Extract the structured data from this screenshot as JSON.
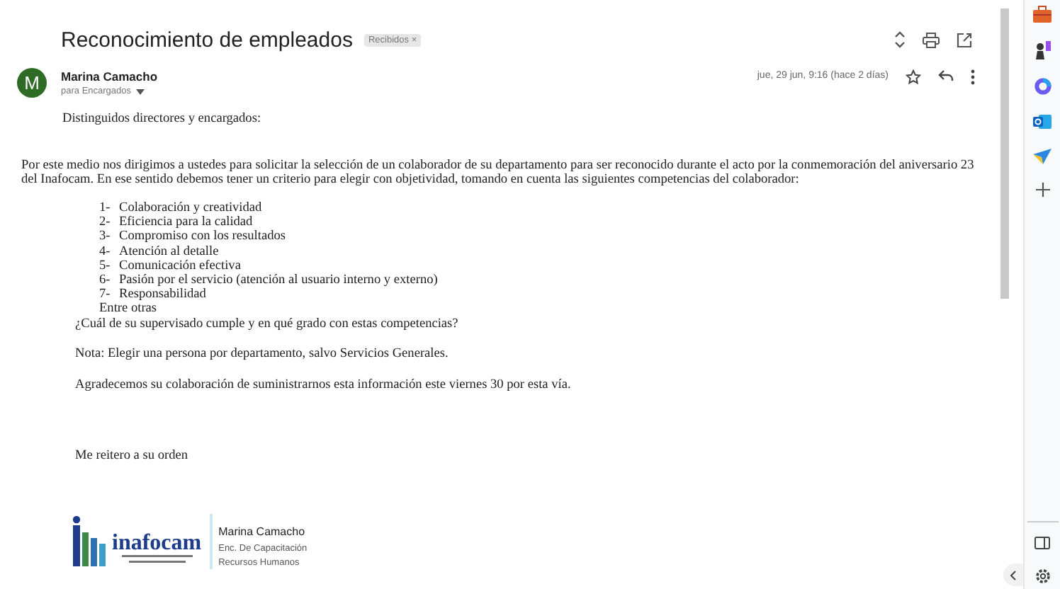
{
  "subject": "Reconocimiento de empleados",
  "label_chip": "Recibidos ×",
  "sender": {
    "initial": "M",
    "name": "Marina Camacho",
    "recipients": "para Encargados",
    "date": "jue, 29 jun, 9:16 (hace 2 días)"
  },
  "body": {
    "greeting": "Distinguidos directores y encargados:",
    "intro": "Por este medio nos dirigimos a ustedes para solicitar la selección de un colaborador de su departamento para ser reconocido durante el acto por la conmemoración del aniversario 23 del Inafocam.  En ese sentido debemos tener un criterio para elegir con objetividad, tomando en cuenta las siguientes competencias del colaborador:",
    "competencies": [
      {
        "number": "1-",
        "text": "Colaboración y creatividad"
      },
      {
        "number": "2-",
        "text": "Eficiencia para la calidad"
      },
      {
        "number": "3-",
        "text": "Compromiso con los resultados"
      },
      {
        "number": "4-",
        "text": "Atención al detalle"
      },
      {
        "number": "5-",
        "text": "Comunicación efectiva"
      },
      {
        "number": "6-",
        "text": "Pasión por el servicio (atención al usuario interno y externo)"
      },
      {
        "number": "7-",
        "text": "Responsabilidad"
      }
    ],
    "list_end": "Entre otras",
    "question": "¿Cuál de su  supervisado cumple y en qué grado con estas competencias?",
    "note": "Nota:  Elegir una persona por departamento, salvo Servicios Generales.",
    "thanks": "Agradecemos su colaboración de suministrarnos esta información este viernes 30 por esta vía.",
    "closing": "Me reitero a su orden"
  },
  "signature": {
    "logo_word": "inafocam",
    "name": "Marina Camacho",
    "role": "Enc. De Capacitación",
    "department": "Recursos Humanos"
  }
}
